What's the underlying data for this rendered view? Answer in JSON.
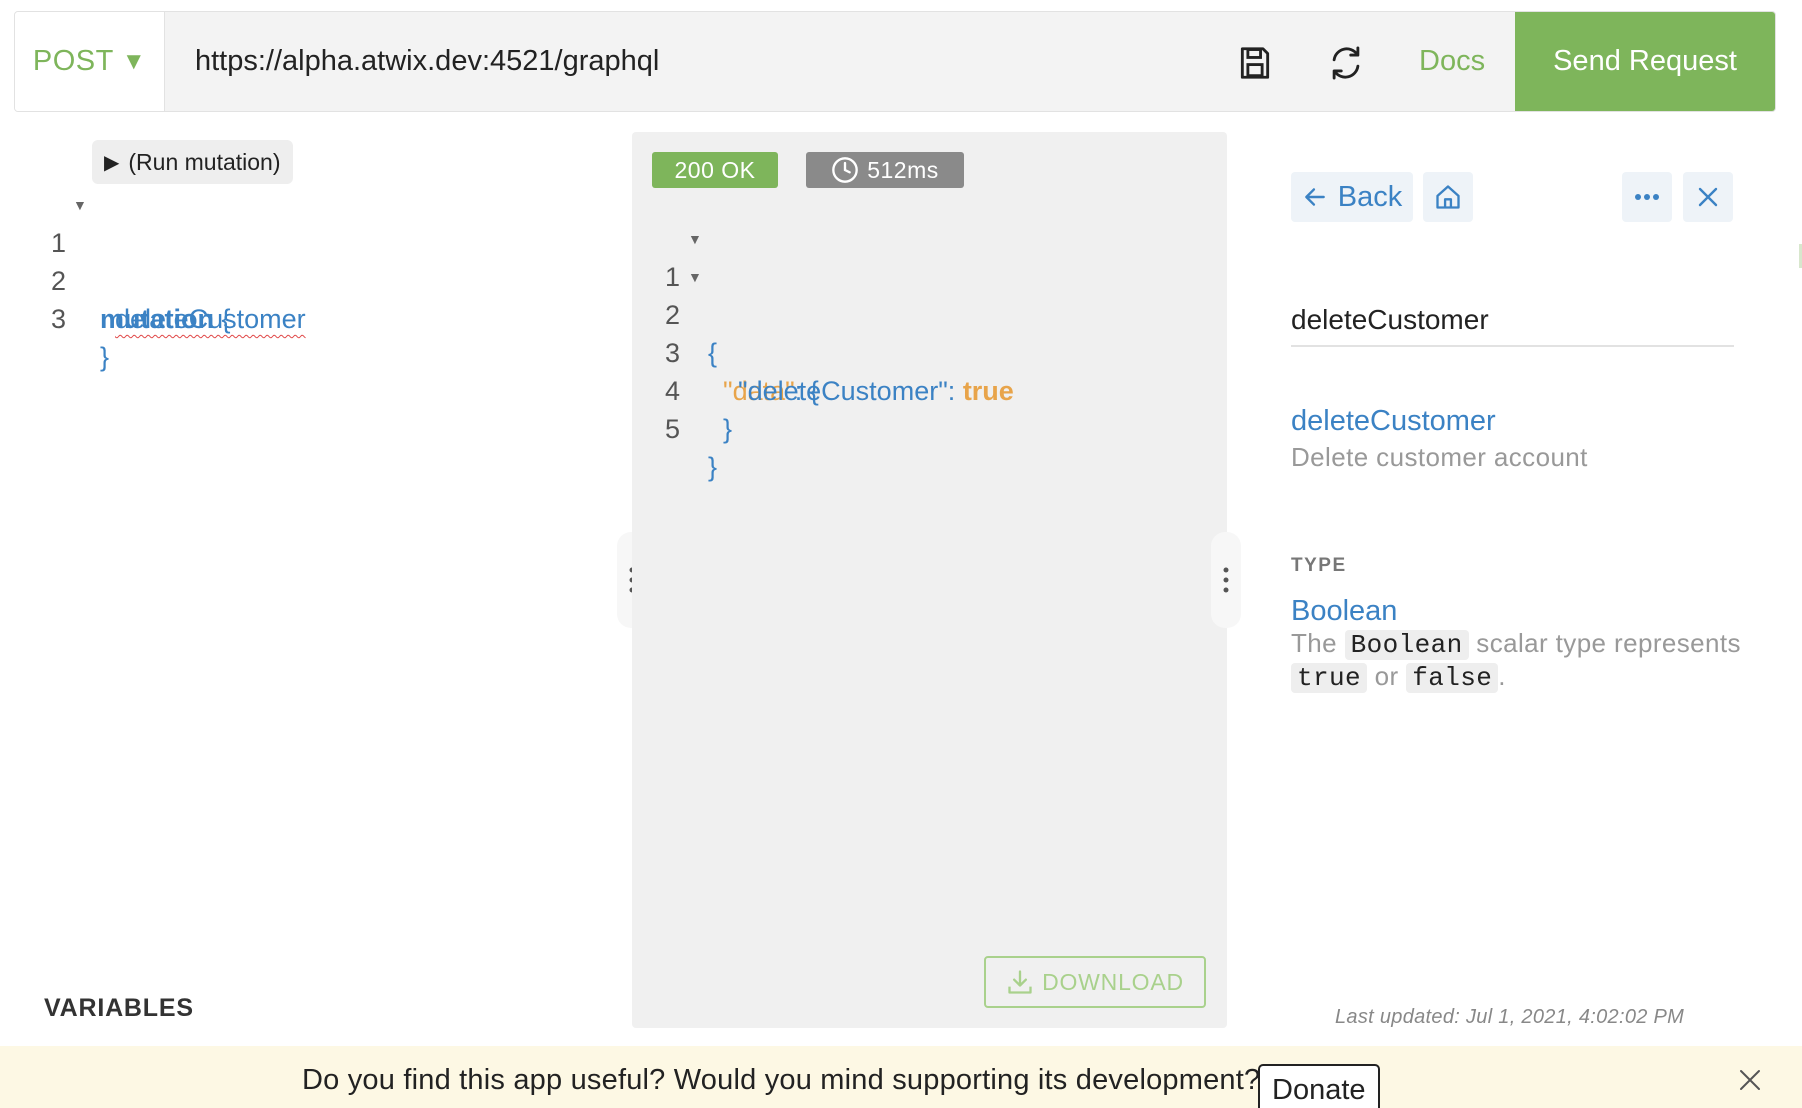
{
  "request": {
    "method": "POST",
    "url": "https://alpha.atwix.dev:4521/graphql",
    "save_icon": "save-icon",
    "refresh_icon": "refresh-icon",
    "docs_label": "Docs",
    "send_label": "Send Request"
  },
  "query": {
    "run_label": "(Run mutation)",
    "lines": [
      {
        "num": "1",
        "keyword": "mutation",
        "brace": "{"
      },
      {
        "num": "2",
        "field": "deleteCustomer"
      },
      {
        "num": "3",
        "brace": "}"
      }
    ],
    "variables_label": "VARIABLES"
  },
  "response": {
    "status": "200 OK",
    "time": "512ms",
    "lines": [
      {
        "num": "1",
        "text": "{"
      },
      {
        "num": "2",
        "key": "\"data\"",
        "sep": ":",
        "text": "{"
      },
      {
        "num": "3",
        "key": "\"deleteCustomer\"",
        "sep": ":",
        "value": "true"
      },
      {
        "num": "4",
        "text": "}"
      },
      {
        "num": "5",
        "text": "}"
      }
    ],
    "download_label": "DOWNLOAD"
  },
  "docs": {
    "back_label": "Back",
    "search_value": "deleteCustomer",
    "field_name": "deleteCustomer",
    "field_description": "Delete customer account",
    "type_heading": "TYPE",
    "type_name": "Boolean",
    "type_desc_1": "The",
    "type_code_1": "Boolean",
    "type_desc_2": "scalar type represents",
    "type_code_2": "true",
    "type_desc_3": "or",
    "type_code_3": "false",
    "type_desc_4": ".",
    "last_updated": "Last updated: Jul 1, 2021, 4:02:02 PM"
  },
  "banner": {
    "text": "Do you find this app useful? Would you mind supporting its development?",
    "donate_label": "Donate"
  },
  "colors": {
    "accent_green": "#7eb55b",
    "link_blue": "#3b82c4",
    "json_orange": "#e8a44a",
    "banner_bg": "#fdf8e4"
  }
}
